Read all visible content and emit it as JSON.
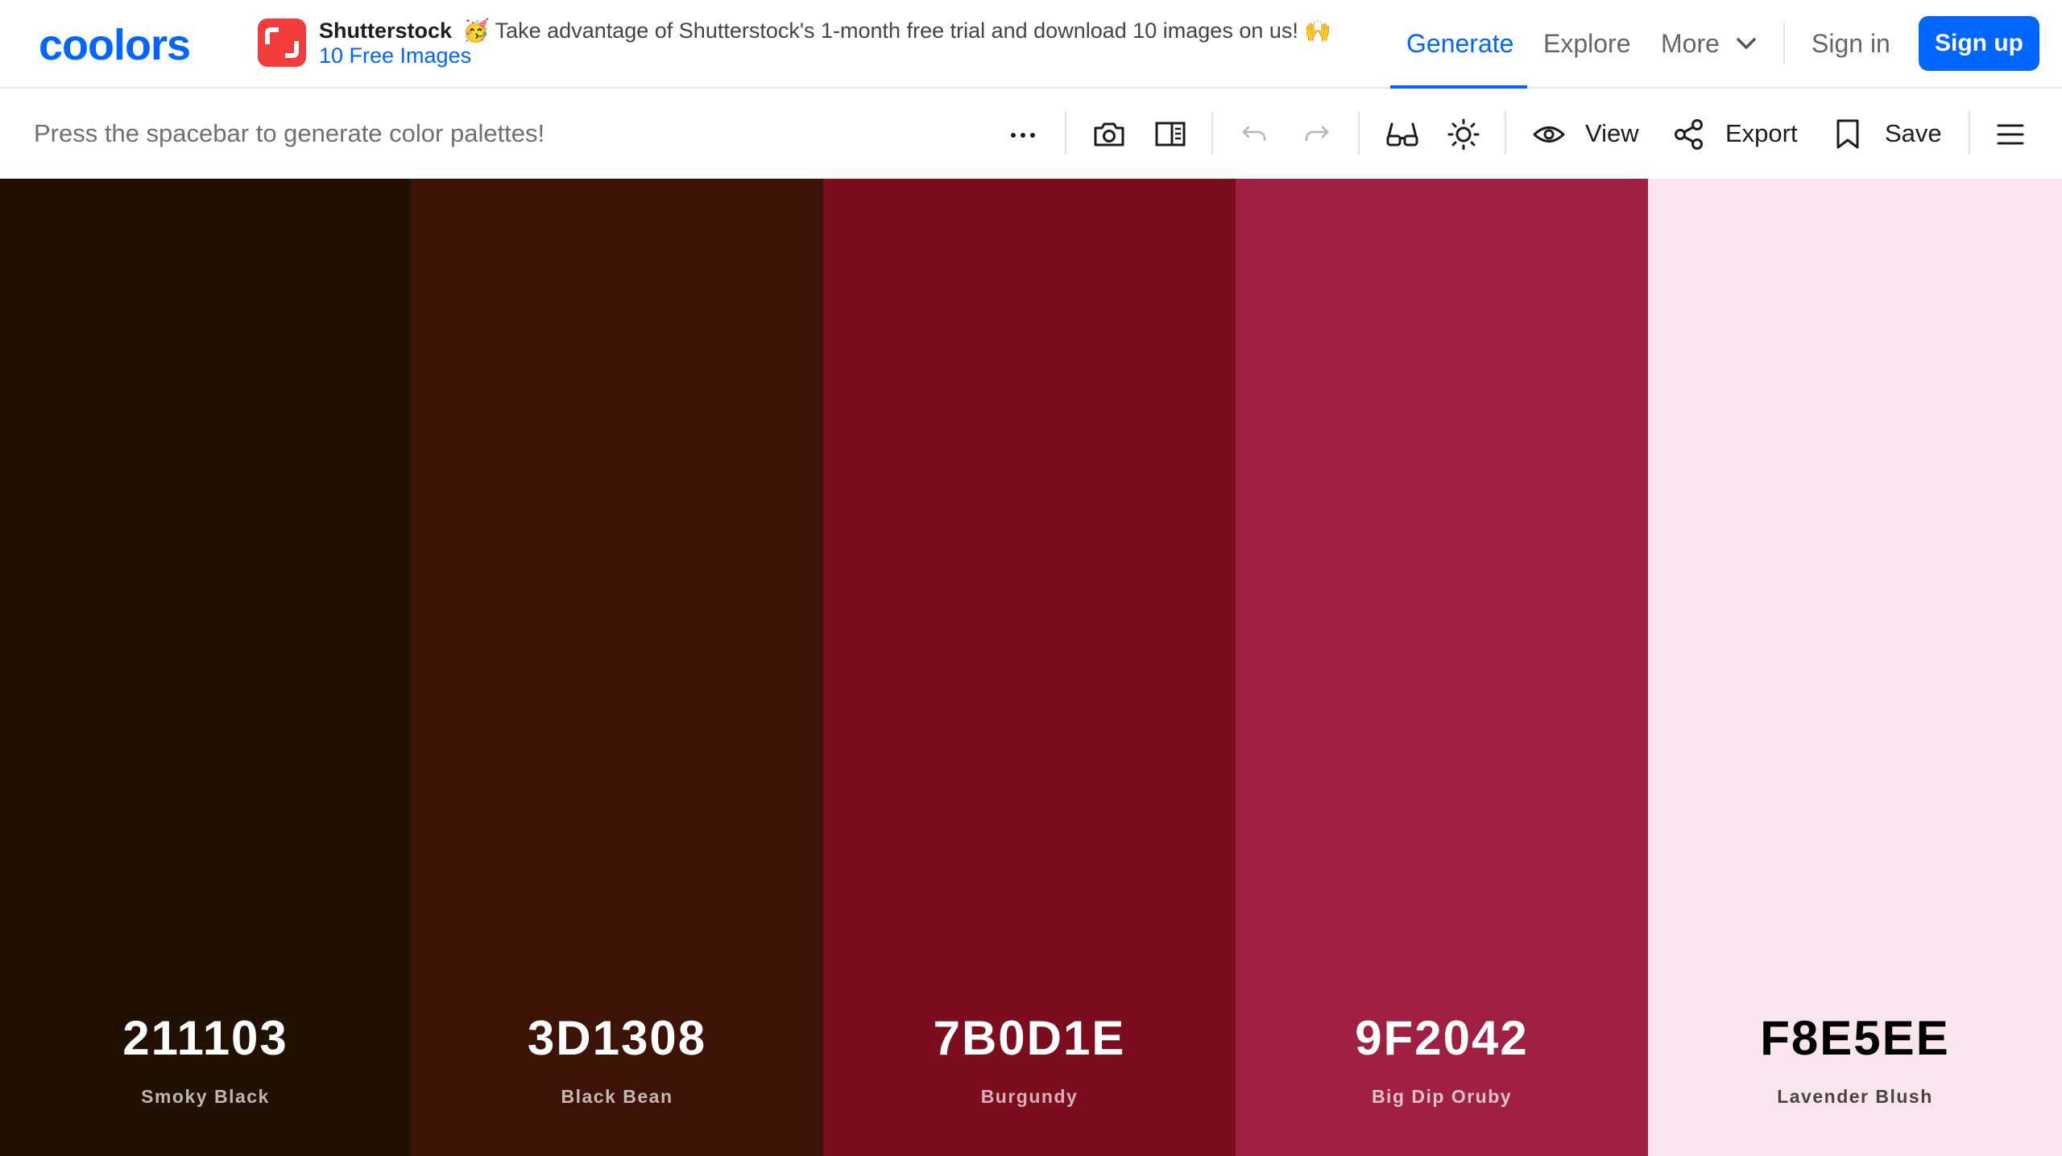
{
  "header": {
    "logo": "coolors",
    "ad": {
      "brand": "Shutterstock",
      "text": "🥳 Take advantage of Shutterstock's 1-month free trial and download 10 images on us! 🙌",
      "link": "10 Free Images",
      "icon": "shutterstock-logo-icon"
    },
    "nav": {
      "generate": "Generate",
      "explore": "Explore",
      "more": "More",
      "sign_in": "Sign in",
      "sign_up": "Sign up",
      "active": "Generate"
    }
  },
  "toolbar": {
    "hint": "Press the spacebar to generate color palettes!",
    "view_label": "View",
    "export_label": "Export",
    "save_label": "Save",
    "icons": [
      "more-options-icon",
      "camera-icon",
      "sidebar-panel-icon",
      "undo-icon",
      "redo-icon",
      "glasses-icon",
      "brightness-icon",
      "eye-icon",
      "share-icon",
      "bookmark-icon",
      "hamburger-menu-icon"
    ]
  },
  "palette": [
    {
      "hex": "211103",
      "name": "Smoky Black",
      "color": "#211103",
      "text_color": "#ffffff",
      "name_color": "#bdb6ae"
    },
    {
      "hex": "3D1308",
      "name": "Black Bean",
      "color": "#3D1308",
      "text_color": "#ffffff",
      "name_color": "#c5b8b4"
    },
    {
      "hex": "7B0D1E",
      "name": "Burgundy",
      "color": "#7B0D1E",
      "text_color": "#ffffff",
      "name_color": "#d9b0b7"
    },
    {
      "hex": "9F2042",
      "name": "Big Dip Oruby",
      "color": "#9F2042",
      "text_color": "#ffffff",
      "name_color": "#e4c0ca"
    },
    {
      "hex": "F8E5EE",
      "name": "Lavender Blush",
      "color": "#F8E5EE",
      "text_color": "#000000",
      "name_color": "#4a4346"
    }
  ],
  "colors": {
    "accent": "#0066ff"
  }
}
